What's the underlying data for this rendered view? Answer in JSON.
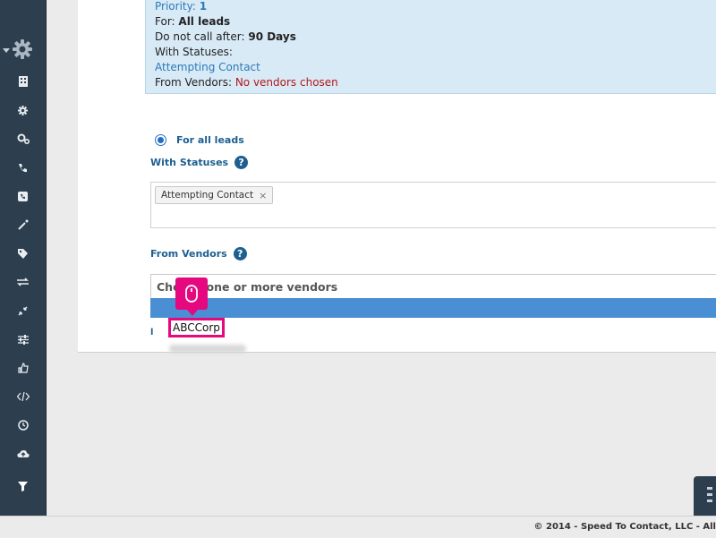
{
  "summary": {
    "priority_label": "Priority: ",
    "priority_value": "1",
    "for_label": "For: ",
    "for_value": "All leads",
    "dnc_label": "Do not call after: ",
    "dnc_value": "90 Days",
    "statuses_label": "With Statuses:",
    "status_value": "Attempting Contact",
    "vendors_label": "From Vendors: ",
    "vendors_value": "No vendors chosen"
  },
  "form": {
    "radio_label": "For all leads",
    "statuses_label": "With Statuses",
    "status_chip": "Attempting Contact",
    "chip_remove": "×",
    "vendors_label": "From Vendors",
    "help_glyph": "?",
    "vendor_placeholder": "Choose one or more vendors",
    "option_abc": "ABCCorp",
    "stray": "l"
  },
  "sidebar": {
    "icons": [
      "gear-icon",
      "building-icon",
      "cog-icon",
      "cogs-icon",
      "phone-icon",
      "phone-square-icon",
      "magic-wand-icon",
      "tag-icon",
      "exchange-icon",
      "compress-icon",
      "sliders-icon",
      "thumbs-up-icon",
      "code-icon",
      "clock-icon",
      "cloud-upload-icon",
      "filter-icon"
    ]
  },
  "footer": {
    "copyright": "© 2014 - Speed To Contact, LLC - All"
  },
  "colors": {
    "sidebar": "#2d3e4e",
    "summary_bg": "#d9eaf7",
    "accent_blue": "#1d5f91",
    "highlight": "#4a8fd4",
    "cursor_pink": "#e6087f",
    "error_red": "#b01818"
  }
}
